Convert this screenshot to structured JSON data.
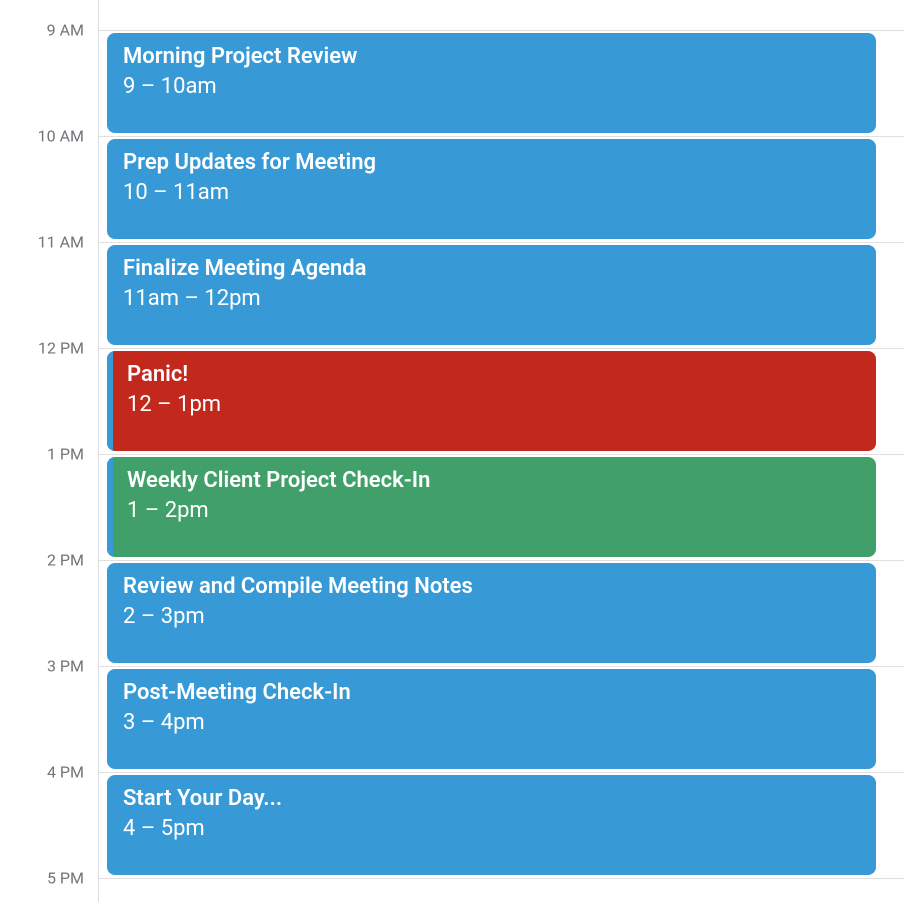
{
  "calendar": {
    "hourHeight": 106,
    "startHour": 9,
    "timeLabels": [
      {
        "hour": 9,
        "text": "9 AM"
      },
      {
        "hour": 10,
        "text": "10 AM"
      },
      {
        "hour": 11,
        "text": "11 AM"
      },
      {
        "hour": 12,
        "text": "12 PM"
      },
      {
        "hour": 13,
        "text": "1 PM"
      },
      {
        "hour": 14,
        "text": "2 PM"
      },
      {
        "hour": 15,
        "text": "3 PM"
      },
      {
        "hour": 16,
        "text": "4 PM"
      },
      {
        "hour": 17,
        "text": "5 PM"
      }
    ],
    "colors": {
      "blue": "#379AD6",
      "red": "#C3281C",
      "green": "#419F69"
    },
    "events": [
      {
        "title": "Morning Project Review",
        "timeText": "9 – 10am",
        "startHour": 9,
        "endHour": 10,
        "color": "blue",
        "accent": false
      },
      {
        "title": "Prep Updates for Meeting",
        "timeText": "10 – 11am",
        "startHour": 10,
        "endHour": 11,
        "color": "blue",
        "accent": false
      },
      {
        "title": "Finalize Meeting Agenda",
        "timeText": "11am – 12pm",
        "startHour": 11,
        "endHour": 12,
        "color": "blue",
        "accent": false
      },
      {
        "title": "Panic!",
        "timeText": "12 – 1pm",
        "startHour": 12,
        "endHour": 13,
        "color": "red",
        "accent": true
      },
      {
        "title": "Weekly Client Project Check-In",
        "timeText": "1 – 2pm",
        "startHour": 13,
        "endHour": 14,
        "color": "green",
        "accent": true
      },
      {
        "title": "Review and Compile Meeting Notes",
        "timeText": "2 – 3pm",
        "startHour": 14,
        "endHour": 15,
        "color": "blue",
        "accent": false
      },
      {
        "title": "Post-Meeting Check-In",
        "timeText": "3 – 4pm",
        "startHour": 15,
        "endHour": 16,
        "color": "blue",
        "accent": false
      },
      {
        "title": "Start Your Day...",
        "timeText": "4 – 5pm",
        "startHour": 16,
        "endHour": 17,
        "color": "blue",
        "accent": false
      }
    ]
  }
}
